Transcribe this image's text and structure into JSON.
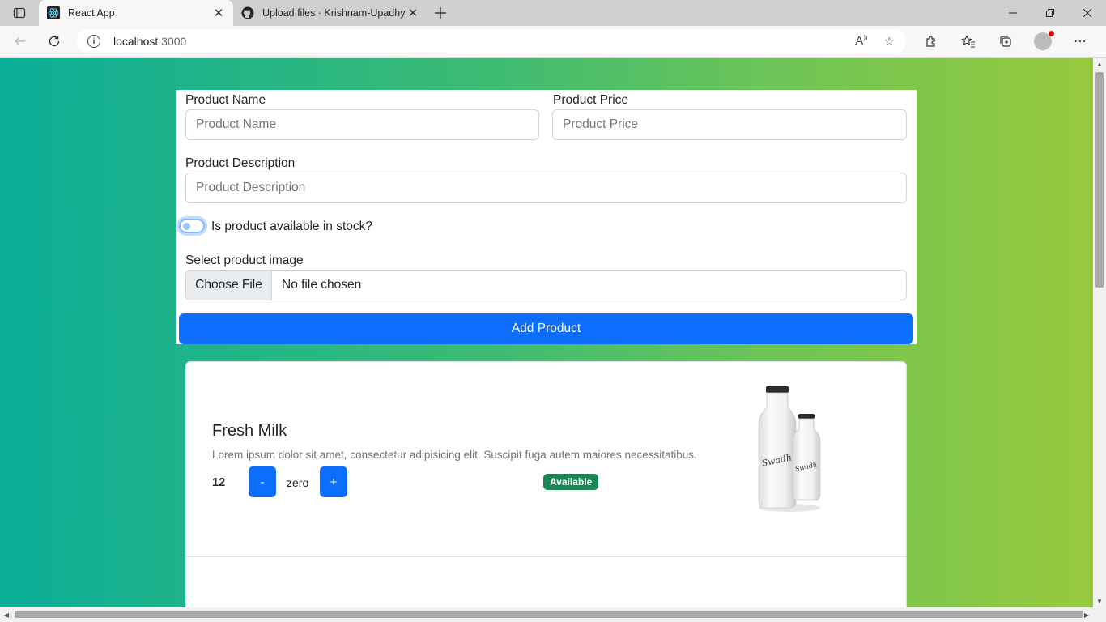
{
  "browser": {
    "tabs": [
      {
        "title": "React App",
        "close": "✕"
      },
      {
        "title": "Upload files · Krishnam-Upadhyay",
        "close": "✕"
      }
    ],
    "url_host": "localhost",
    "url_port": ":3000"
  },
  "form": {
    "name_label": "Product Name",
    "name_placeholder": "Product Name",
    "price_label": "Product Price",
    "price_placeholder": "Product Price",
    "desc_label": "Product Description",
    "desc_placeholder": "Product Description",
    "stock_label": "Is product available in stock?",
    "image_label": "Select product image",
    "choose_file": "Choose File",
    "no_file": "No file chosen",
    "submit": "Add Product"
  },
  "product": {
    "name": "Fresh Milk",
    "description": "Lorem ipsum dolor sit amet, consectetur adipisicing elit. Suscipit fuga autem maiores necessitatibus.",
    "price": "12",
    "minus": "-",
    "quantity": "zero",
    "plus": "+",
    "status": "Available"
  },
  "colors": {
    "primary": "#0d6efd",
    "success": "#198754",
    "gradient_start": "#0bae98",
    "gradient_end": "#98c93c"
  }
}
